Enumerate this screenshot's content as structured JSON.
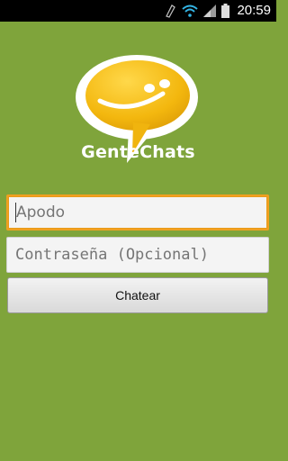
{
  "status_bar": {
    "time": "20:59"
  },
  "brand": {
    "name": "GenteChats"
  },
  "form": {
    "nickname_placeholder": "Apodo",
    "password_placeholder": "Contraseña (Opcional)",
    "submit_label": "Chatear"
  },
  "colors": {
    "background": "#7fa43b",
    "accent": "#f0a020",
    "logo_yellow": "#f5c010"
  }
}
